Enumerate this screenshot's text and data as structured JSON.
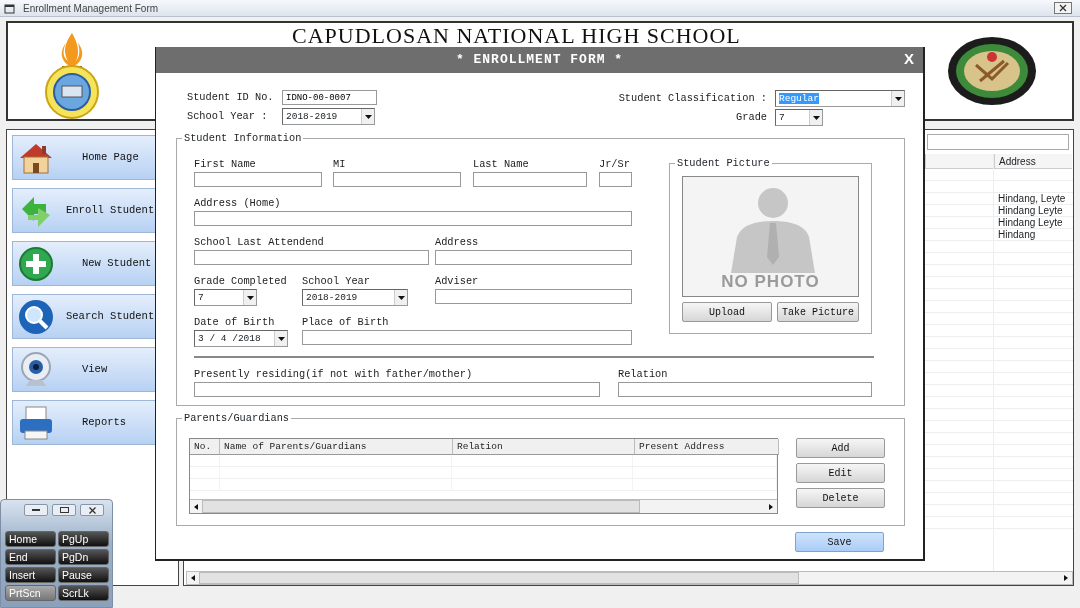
{
  "app_window": {
    "title": "Enrollment Management Form"
  },
  "header": {
    "school_name": "CAPUDLOSAN NATIONAL HIGH SCHOOL"
  },
  "sidebar": {
    "items": [
      {
        "label": "Home Page"
      },
      {
        "label": "Enroll Student"
      },
      {
        "label": "New Student"
      },
      {
        "label": "Search Student"
      },
      {
        "label": "View"
      },
      {
        "label": "Reports"
      }
    ]
  },
  "student_list": {
    "columns": [
      "Address"
    ],
    "rows": [
      [
        "Hindang, Leyte"
      ],
      [
        "Hindang Leyte"
      ],
      [
        "Hindang Leyte"
      ],
      [
        "Hindang"
      ]
    ]
  },
  "keyboard": {
    "keys": [
      {
        "label": "Home",
        "pressed": false
      },
      {
        "label": "PgUp",
        "pressed": false
      },
      {
        "label": "End",
        "pressed": false
      },
      {
        "label": "PgDn",
        "pressed": false
      },
      {
        "label": "Insert",
        "pressed": false
      },
      {
        "label": "Pause",
        "pressed": false
      },
      {
        "label": "PrtScn",
        "pressed": true
      },
      {
        "label": "ScrLk",
        "pressed": false
      }
    ]
  },
  "enrollment_form": {
    "title": "* ENROLLMENT FORM *",
    "close": "X",
    "student_id": {
      "label": "Student ID No.",
      "value": "IDNO-00-0007"
    },
    "school_year": {
      "label": "School Year :",
      "value": "2018-2019"
    },
    "classification": {
      "label": "Student Classification :",
      "value": "Regular",
      "text_selected": true
    },
    "grade": {
      "label": "Grade",
      "value": "7"
    },
    "student_information": {
      "legend": "Student Information",
      "rows": [
        [
          {
            "label": "First Name",
            "kind": "text"
          },
          {
            "label": "MI",
            "kind": "text"
          },
          {
            "label": "Last Name",
            "kind": "text"
          },
          {
            "label": "Jr/Sr",
            "kind": "text"
          }
        ],
        [
          {
            "label": "Address (Home)",
            "kind": "text"
          }
        ],
        [
          {
            "label": "School Last Attendend",
            "kind": "text"
          },
          {
            "label": "Address",
            "kind": "text"
          }
        ],
        [
          {
            "label": "Grade Completed",
            "kind": "dropdown",
            "value": "7"
          },
          {
            "label": "School Year",
            "kind": "dropdown",
            "value": "2018-2019"
          },
          {
            "label": "Adviser",
            "kind": "text"
          }
        ],
        [
          {
            "label": "Date of Birth",
            "kind": "date",
            "value": "3 / 4 /2018"
          },
          {
            "label": "Place of Birth",
            "kind": "text"
          }
        ]
      ],
      "residence_row": [
        {
          "label": "Presently residing(if not with father/mother)",
          "kind": "text"
        },
        {
          "label": "Relation",
          "kind": "text"
        }
      ],
      "picture": {
        "legend": "Student Picture",
        "caption": "NO PHOTO",
        "buttons": [
          "Upload",
          "Take Picture"
        ]
      }
    },
    "parents": {
      "legend": "Parents/Guardians",
      "columns": [
        "No.",
        "Name of Parents/Guardians",
        "Relation",
        "Present Address"
      ],
      "buttons": [
        "Add",
        "Edit",
        "Delete"
      ]
    },
    "save_button": {
      "label": "Save",
      "default": true
    }
  }
}
